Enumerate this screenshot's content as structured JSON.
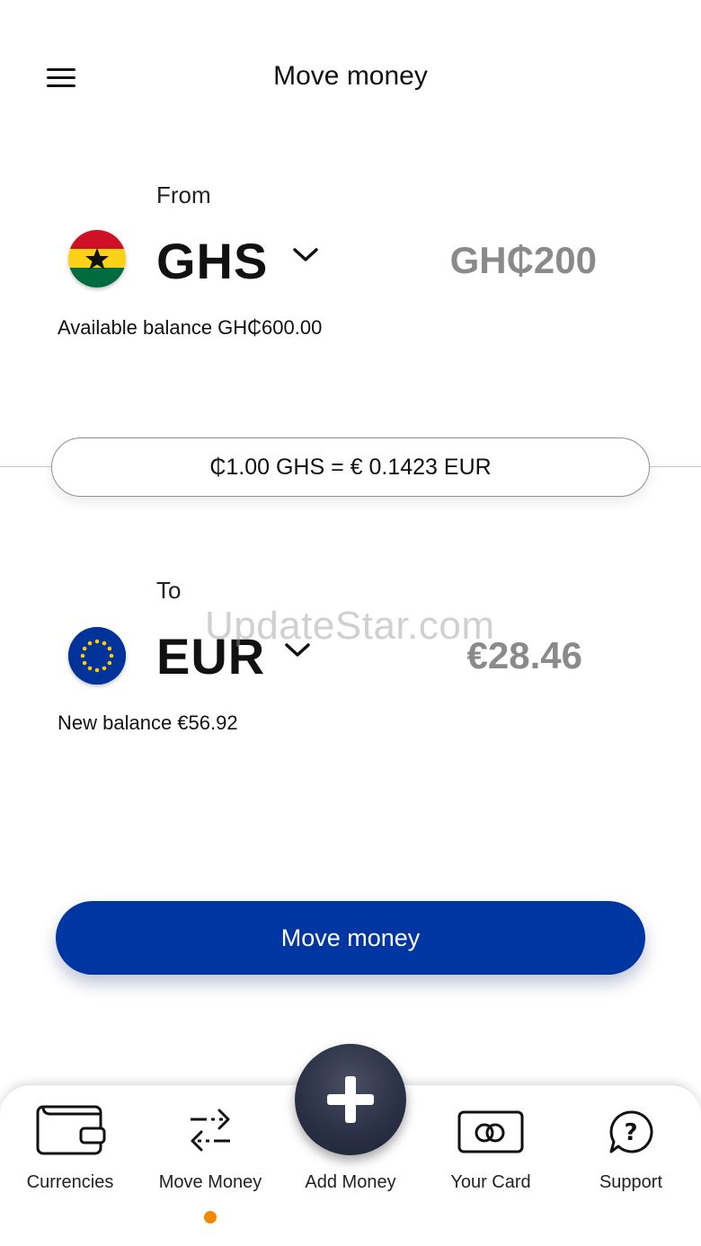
{
  "header": {
    "title": "Move money"
  },
  "from": {
    "label": "From",
    "currency": "GHS",
    "amount": "GH₵200",
    "balance": "Available balance GH₵600.00"
  },
  "rate": {
    "text": "₵1.00 GHS = € 0.1423 EUR"
  },
  "to": {
    "label": "To",
    "currency": "EUR",
    "amount": "€28.46",
    "balance": "New balance €56.92"
  },
  "watermark": "UpdateStar.com",
  "action": {
    "label": "Move money"
  },
  "nav": {
    "items": [
      {
        "label": "Currencies",
        "icon": "wallet-icon"
      },
      {
        "label": "Move Money",
        "icon": "transfer-arrows-icon",
        "active": true
      },
      {
        "label": "Add Money",
        "icon": "plus-icon"
      },
      {
        "label": "Your Card",
        "icon": "card-icon"
      },
      {
        "label": "Support",
        "icon": "help-icon"
      }
    ]
  },
  "colors": {
    "primary": "#0036a1",
    "active_dot": "#f08a00",
    "fab": "#2b3146"
  }
}
